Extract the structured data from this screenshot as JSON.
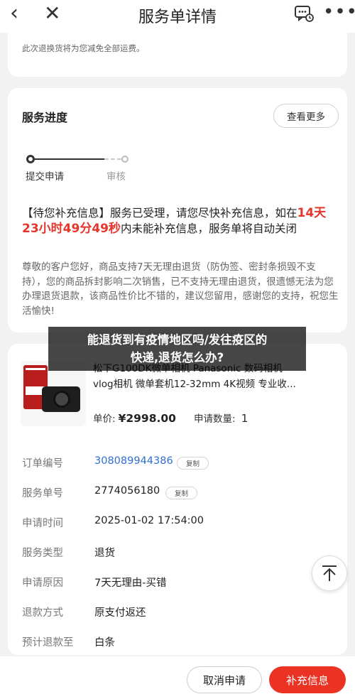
{
  "nav": {
    "title": "服务单详情"
  },
  "notice": {
    "text": "此次退换货将为您减免全部运费。"
  },
  "progress": {
    "heading": "服务进度",
    "more_label": "查看更多",
    "steps": [
      {
        "label": "提交申请",
        "state": "done"
      },
      {
        "label": "审核",
        "state": "pending"
      }
    ],
    "status_prefix": "【待您补充信息】服务已受理，请您尽快补充信息，如在",
    "countdown": "14天23小时49分49秒",
    "status_suffix": "内未能补充信息，服务单将自动关闭",
    "description": "尊敬的客户您好，商品支持7天无理由退货（防伪签、密封条损毁不支持），您的商品拆封影响二次销售，已不支持无理由退货，很遗憾无法为您办理退货退款，该商品性价比不错的，建议您留用，感谢您的支持，祝您生活愉快!"
  },
  "product": {
    "name": "松下G100DK微单相机 Panasonic 数码相机 vlog相机 微单套机12-32mm 4K视频 专业收...",
    "price_label": "单价:",
    "price": "¥2998.00",
    "qty_label": "申请数量:",
    "qty": "1"
  },
  "details": {
    "order_no": {
      "label": "订单编号",
      "value": "308089944386",
      "copy": "复制"
    },
    "service_no": {
      "label": "服务单号",
      "value": "2774056180",
      "copy": "复制"
    },
    "apply_time": {
      "label": "申请时间",
      "value": "2025-01-02 17:54:00"
    },
    "service_type": {
      "label": "服务类型",
      "value": "退货"
    },
    "reason": {
      "label": "申请原因",
      "value": "7天无理由-买错"
    },
    "refund_method": {
      "label": "退款方式",
      "value": "原支付返还"
    },
    "refund_to": {
      "label": "预计退款至",
      "value": "白条"
    }
  },
  "bottom": {
    "cancel_label": "取消申请",
    "supplement_label": "补充信息"
  },
  "overlay": {
    "line1": "能退货到有疫情地区吗/发往疫区的",
    "line2": "快递,退货怎么办?"
  },
  "colors": {
    "accent_red": "#ea3323",
    "link_blue": "#2f6fd4"
  }
}
